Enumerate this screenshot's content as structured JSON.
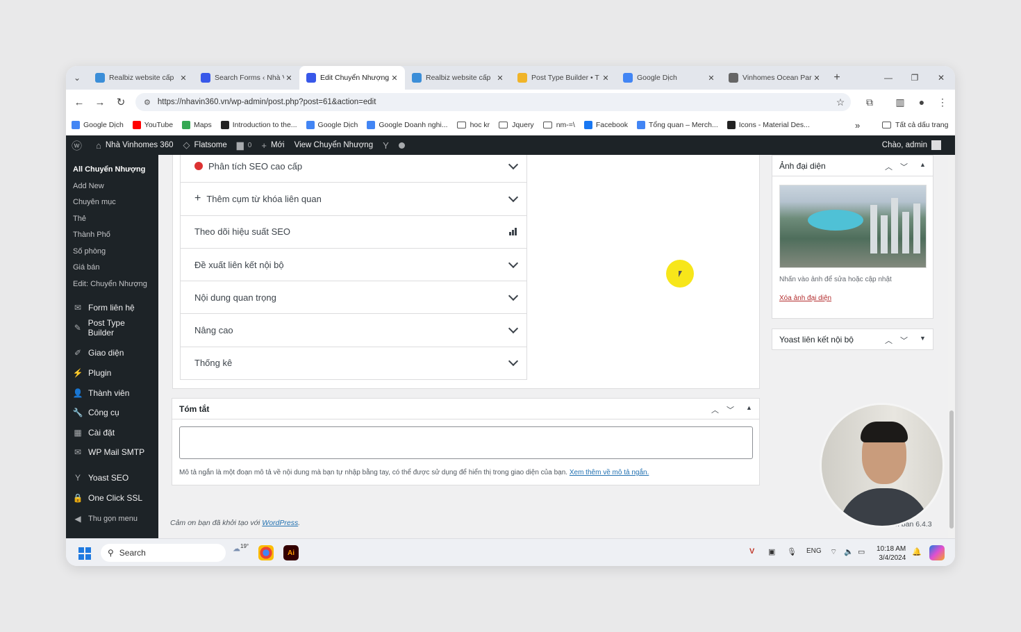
{
  "browser": {
    "tabs": [
      {
        "title": "Realbiz website cấp",
        "fav_color": "#3b8ed8"
      },
      {
        "title": "Search Forms ‹ Nhà V",
        "fav_color": "#3858e9"
      },
      {
        "title": "Edit Chuyển Nhượng",
        "fav_color": "#3858e9",
        "active": true
      },
      {
        "title": "Realbiz website cấp",
        "fav_color": "#3b8ed8"
      },
      {
        "title": "Post Type Builder • T",
        "fav_color": "#f0b429"
      },
      {
        "title": "Google Dịch",
        "fav_color": "#4285f4"
      },
      {
        "title": "Vinhomes Ocean Par",
        "fav_color": "#666666"
      }
    ],
    "url": "https://nhavin360.vn/wp-admin/post.php?post=61&action=edit",
    "bookmarks": [
      {
        "label": "Google Dịch",
        "color": "#4285f4"
      },
      {
        "label": "YouTube",
        "color": "#ff0000"
      },
      {
        "label": "Maps",
        "color": "#34a853"
      },
      {
        "label": "Introduction to the...",
        "color": "#222222"
      },
      {
        "label": "Google Dịch",
        "color": "#4285f4"
      },
      {
        "label": "Google Doanh nghi...",
        "color": "#4285f4"
      },
      {
        "label": "hoc kr",
        "folder": true
      },
      {
        "label": "Jquery",
        "folder": true
      },
      {
        "label": "nm-=\\",
        "folder": true
      },
      {
        "label": "Facebook",
        "color": "#1877f2"
      },
      {
        "label": "Tổng quan – Merch...",
        "color": "#4285f4"
      },
      {
        "label": "Icons - Material Des...",
        "color": "#222222"
      }
    ],
    "all_bookmarks": "Tất cả dấu trang"
  },
  "adminbar": {
    "site": "Nhà Vinhomes 360",
    "theme": "Flatsome",
    "comments": "0",
    "new": "Mới",
    "view": "View Chuyển Nhượng",
    "greeting": "Chào, admin"
  },
  "sidebar": {
    "submenu": [
      "All Chuyển Nhượng",
      "Add New",
      "Chuyên mục",
      "Thẻ",
      "Thành Phố",
      "Số phòng",
      "Giá bán",
      "Edit: Chuyển Nhượng"
    ],
    "menu": [
      {
        "label": "Form liên hệ",
        "icon": "mail-icon"
      },
      {
        "label": "Post Type Builder",
        "icon": "edit-icon"
      },
      {
        "label": "Giao diện",
        "icon": "brush-icon"
      },
      {
        "label": "Plugin",
        "icon": "plugin-icon"
      },
      {
        "label": "Thành viên",
        "icon": "user-icon"
      },
      {
        "label": "Công cụ",
        "icon": "wrench-icon"
      },
      {
        "label": "Cài đặt",
        "icon": "settings-icon"
      },
      {
        "label": "WP Mail SMTP",
        "icon": "mail-icon"
      },
      {
        "label": "Yoast SEO",
        "icon": "yoast-icon"
      },
      {
        "label": "One Click SSL",
        "icon": "lock-icon"
      },
      {
        "label": "Thu gọn menu",
        "icon": "collapse-icon"
      }
    ]
  },
  "yoast": {
    "rows": [
      {
        "label": "Phân tích SEO cao cấp",
        "prefix": "red-dot"
      },
      {
        "label": "Thêm cụm từ khóa liên quan",
        "prefix": "plus"
      },
      {
        "label": "Theo dõi hiệu suất SEO",
        "suffix": "bars"
      },
      {
        "label": "Đề xuất liên kết nội bộ"
      },
      {
        "label": "Nội dung quan trọng"
      },
      {
        "label": "Nâng cao"
      },
      {
        "label": "Thống kê"
      }
    ]
  },
  "excerpt": {
    "title": "Tóm tắt",
    "help": "Mô tả ngắn là một đoạn mô tả về nội dung mà bạn tự nhập bằng tay, có thể được sử dụng để hiển thị trong giao diện của bạn.",
    "help_link": "Xem thêm về mô tả ngắn."
  },
  "featured": {
    "title": "Ảnh đại diện",
    "note": "Nhấn vào ảnh để sửa hoặc cập nhật",
    "remove": "Xóa ảnh đại diện"
  },
  "linkbox": {
    "title": "Yoast liên kết nội bộ"
  },
  "footer": {
    "prefix": "Cảm ơn bạn đã khởi tạo với",
    "link": "WordPress",
    "suffix": ".",
    "version": "Phiên bản 6.4.3"
  },
  "taskbar": {
    "search": "Search",
    "temp": "19°",
    "lang": "ENG",
    "time": "10:18 AM",
    "date": "3/4/2024"
  }
}
